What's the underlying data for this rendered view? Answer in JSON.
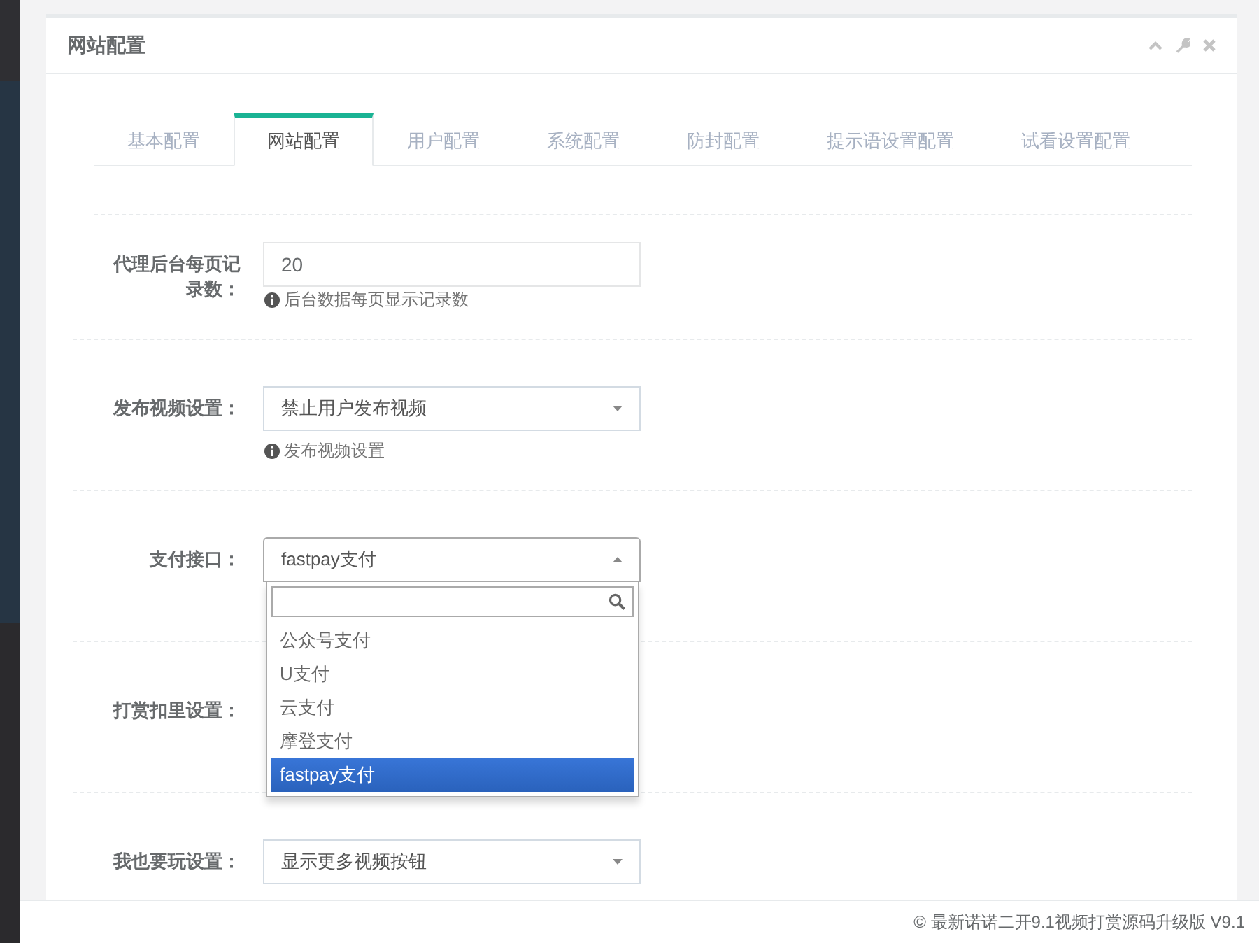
{
  "panel": {
    "title": "网站配置"
  },
  "tabs": [
    {
      "label": "基本配置",
      "selected": false
    },
    {
      "label": "网站配置",
      "selected": true
    },
    {
      "label": "用户配置",
      "selected": false
    },
    {
      "label": "系统配置",
      "selected": false
    },
    {
      "label": "防封配置",
      "selected": false
    },
    {
      "label": "提示语设置配置",
      "selected": false
    },
    {
      "label": "试看设置配置",
      "selected": false
    }
  ],
  "form": {
    "rows": [
      {
        "kind": "input",
        "label": "代理后台每页记录数：",
        "value": "20",
        "help": "后台数据每页显示记录数"
      },
      {
        "kind": "select",
        "label": "发布视频设置：",
        "value": "禁止用户发布视频",
        "expanded": false,
        "help": "发布视频设置"
      },
      {
        "kind": "select",
        "label": "支付接口：",
        "value": "fastpay支付",
        "expanded": true,
        "options": [
          {
            "label": "公众号支付",
            "selected": false
          },
          {
            "label": "U支付",
            "selected": false
          },
          {
            "label": "云支付",
            "selected": false
          },
          {
            "label": "摩登支付",
            "selected": false
          },
          {
            "label": "fastpay支付",
            "selected": true
          }
        ]
      },
      {
        "kind": "label",
        "label": "打赏扣里设置："
      },
      {
        "kind": "select",
        "label": "我也要玩设置：",
        "value": "显示更多视频按钮",
        "expanded": false
      }
    ]
  },
  "footer": {
    "text": "© 最新诺诺二开9.1视频打赏源码升级版 V9.1"
  }
}
